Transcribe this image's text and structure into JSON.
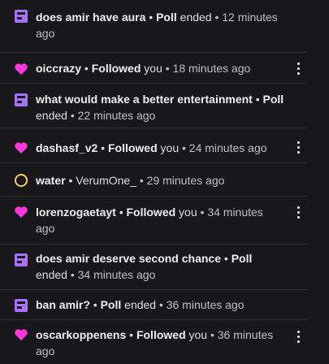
{
  "notifications": [
    {
      "type": "poll",
      "subject": "does amir have aura ",
      "sep1": " • ",
      "event": "Poll",
      "rest": " ended",
      "time": " • 12 minutes ago"
    },
    {
      "type": "follow",
      "subject": "oiccrazy",
      "sep1": " • ",
      "event": "Followed",
      "rest": " you",
      "time": " • 18 minutes ago"
    },
    {
      "type": "poll",
      "subject": "what would make a better entertainment",
      "sep1": " • ",
      "event": "Poll",
      "rest": " ended",
      "time": " • 22 minutes ago"
    },
    {
      "type": "follow",
      "subject": "dashasf_v2",
      "sep1": " • ",
      "event": "Followed",
      "rest": " you",
      "time": " • 24 minutes ago"
    },
    {
      "type": "prediction",
      "subject": "water",
      "sep1": " • ",
      "event": "",
      "rest": "VerumOne_",
      "time": " • 29 minutes ago"
    },
    {
      "type": "follow",
      "subject": "lorenzogaetayt",
      "sep1": " • ",
      "event": "Followed",
      "rest": " you",
      "time": " • 34 minutes ago"
    },
    {
      "type": "poll",
      "subject": "does amir deserve second chance",
      "sep1": " • ",
      "event": "Poll",
      "rest": " ended",
      "time": " • 34 minutes ago"
    },
    {
      "type": "poll",
      "subject": "ban amir?",
      "sep1": " • ",
      "event": "Poll",
      "rest": " ended",
      "time": " • 36 minutes ago"
    },
    {
      "type": "follow",
      "subject": "oscarkoppenens",
      "sep1": " • ",
      "event": "Followed",
      "rest": " you",
      "time": " • 36 minutes ago"
    }
  ],
  "colors": {
    "poll_icon": "#a970ff",
    "follow_icon": "#ff38db",
    "prediction_icon": "#f5c56a"
  }
}
